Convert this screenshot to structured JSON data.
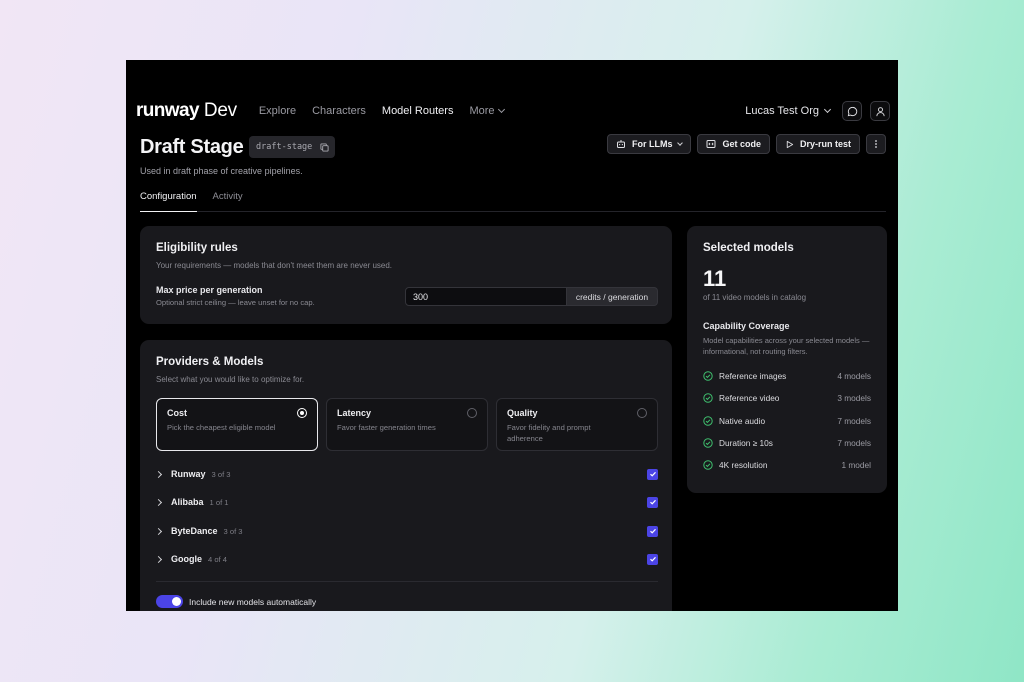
{
  "app": {
    "logo_word": "runway",
    "logo_suffix": "Dev"
  },
  "nav": {
    "links": [
      {
        "label": "Explore"
      },
      {
        "label": "Characters"
      },
      {
        "label": "Model Routers",
        "active": true
      },
      {
        "label": "More"
      }
    ],
    "org": "Lucas Test Org",
    "icons": [
      "chat-icon",
      "user-icon"
    ]
  },
  "header": {
    "title": "Draft Stage",
    "slug": "draft-stage",
    "subtitle": "Used in draft phase of creative pipelines.",
    "actions": {
      "for_llms": "For LLMs",
      "get_code": "Get code",
      "dry_run": "Dry-run test"
    }
  },
  "tabs": [
    {
      "label": "Configuration",
      "active": true
    },
    {
      "label": "Activity"
    }
  ],
  "eligibility": {
    "title": "Eligibility rules",
    "description": "Your requirements — models that don't meet them are never used.",
    "max_price": {
      "label": "Max price per generation",
      "hint": "Optional strict ceiling — leave unset for no cap.",
      "value": "300",
      "unit": "credits / generation"
    }
  },
  "providers": {
    "title": "Providers & Models",
    "description": "Select what you would like to optimize for.",
    "options": [
      {
        "title": "Cost",
        "desc": "Pick the cheapest eligible model",
        "selected": true
      },
      {
        "title": "Latency",
        "desc": "Favor faster generation times",
        "selected": false
      },
      {
        "title": "Quality",
        "desc": "Favor fidelity and prompt adherence",
        "selected": false
      }
    ],
    "list": [
      {
        "name": "Runway",
        "count": "3 of 3",
        "checked": true
      },
      {
        "name": "Alibaba",
        "count": "1 of 1",
        "checked": true
      },
      {
        "name": "ByteDance",
        "count": "3 of 3",
        "checked": true
      },
      {
        "name": "Google",
        "count": "4 of 4",
        "checked": true
      }
    ],
    "auto_include": {
      "label": "Include new models automatically",
      "on": true
    }
  },
  "selected": {
    "title": "Selected models",
    "count": "11",
    "subtitle": "of 11 video models in catalog",
    "coverage": {
      "title": "Capability Coverage",
      "description": "Model capabilities across your selected models — informational, not routing filters.",
      "items": [
        {
          "label": "Reference images",
          "count": "4 models"
        },
        {
          "label": "Reference video",
          "count": "3 models"
        },
        {
          "label": "Native audio",
          "count": "7 models"
        },
        {
          "label": "Duration ≥ 10s",
          "count": "7 models"
        },
        {
          "label": "4K resolution",
          "count": "1 model"
        }
      ]
    }
  },
  "colors": {
    "accent": "#4b44e6",
    "check_green": "#3fbf6e",
    "card_bg": "#19191d"
  }
}
